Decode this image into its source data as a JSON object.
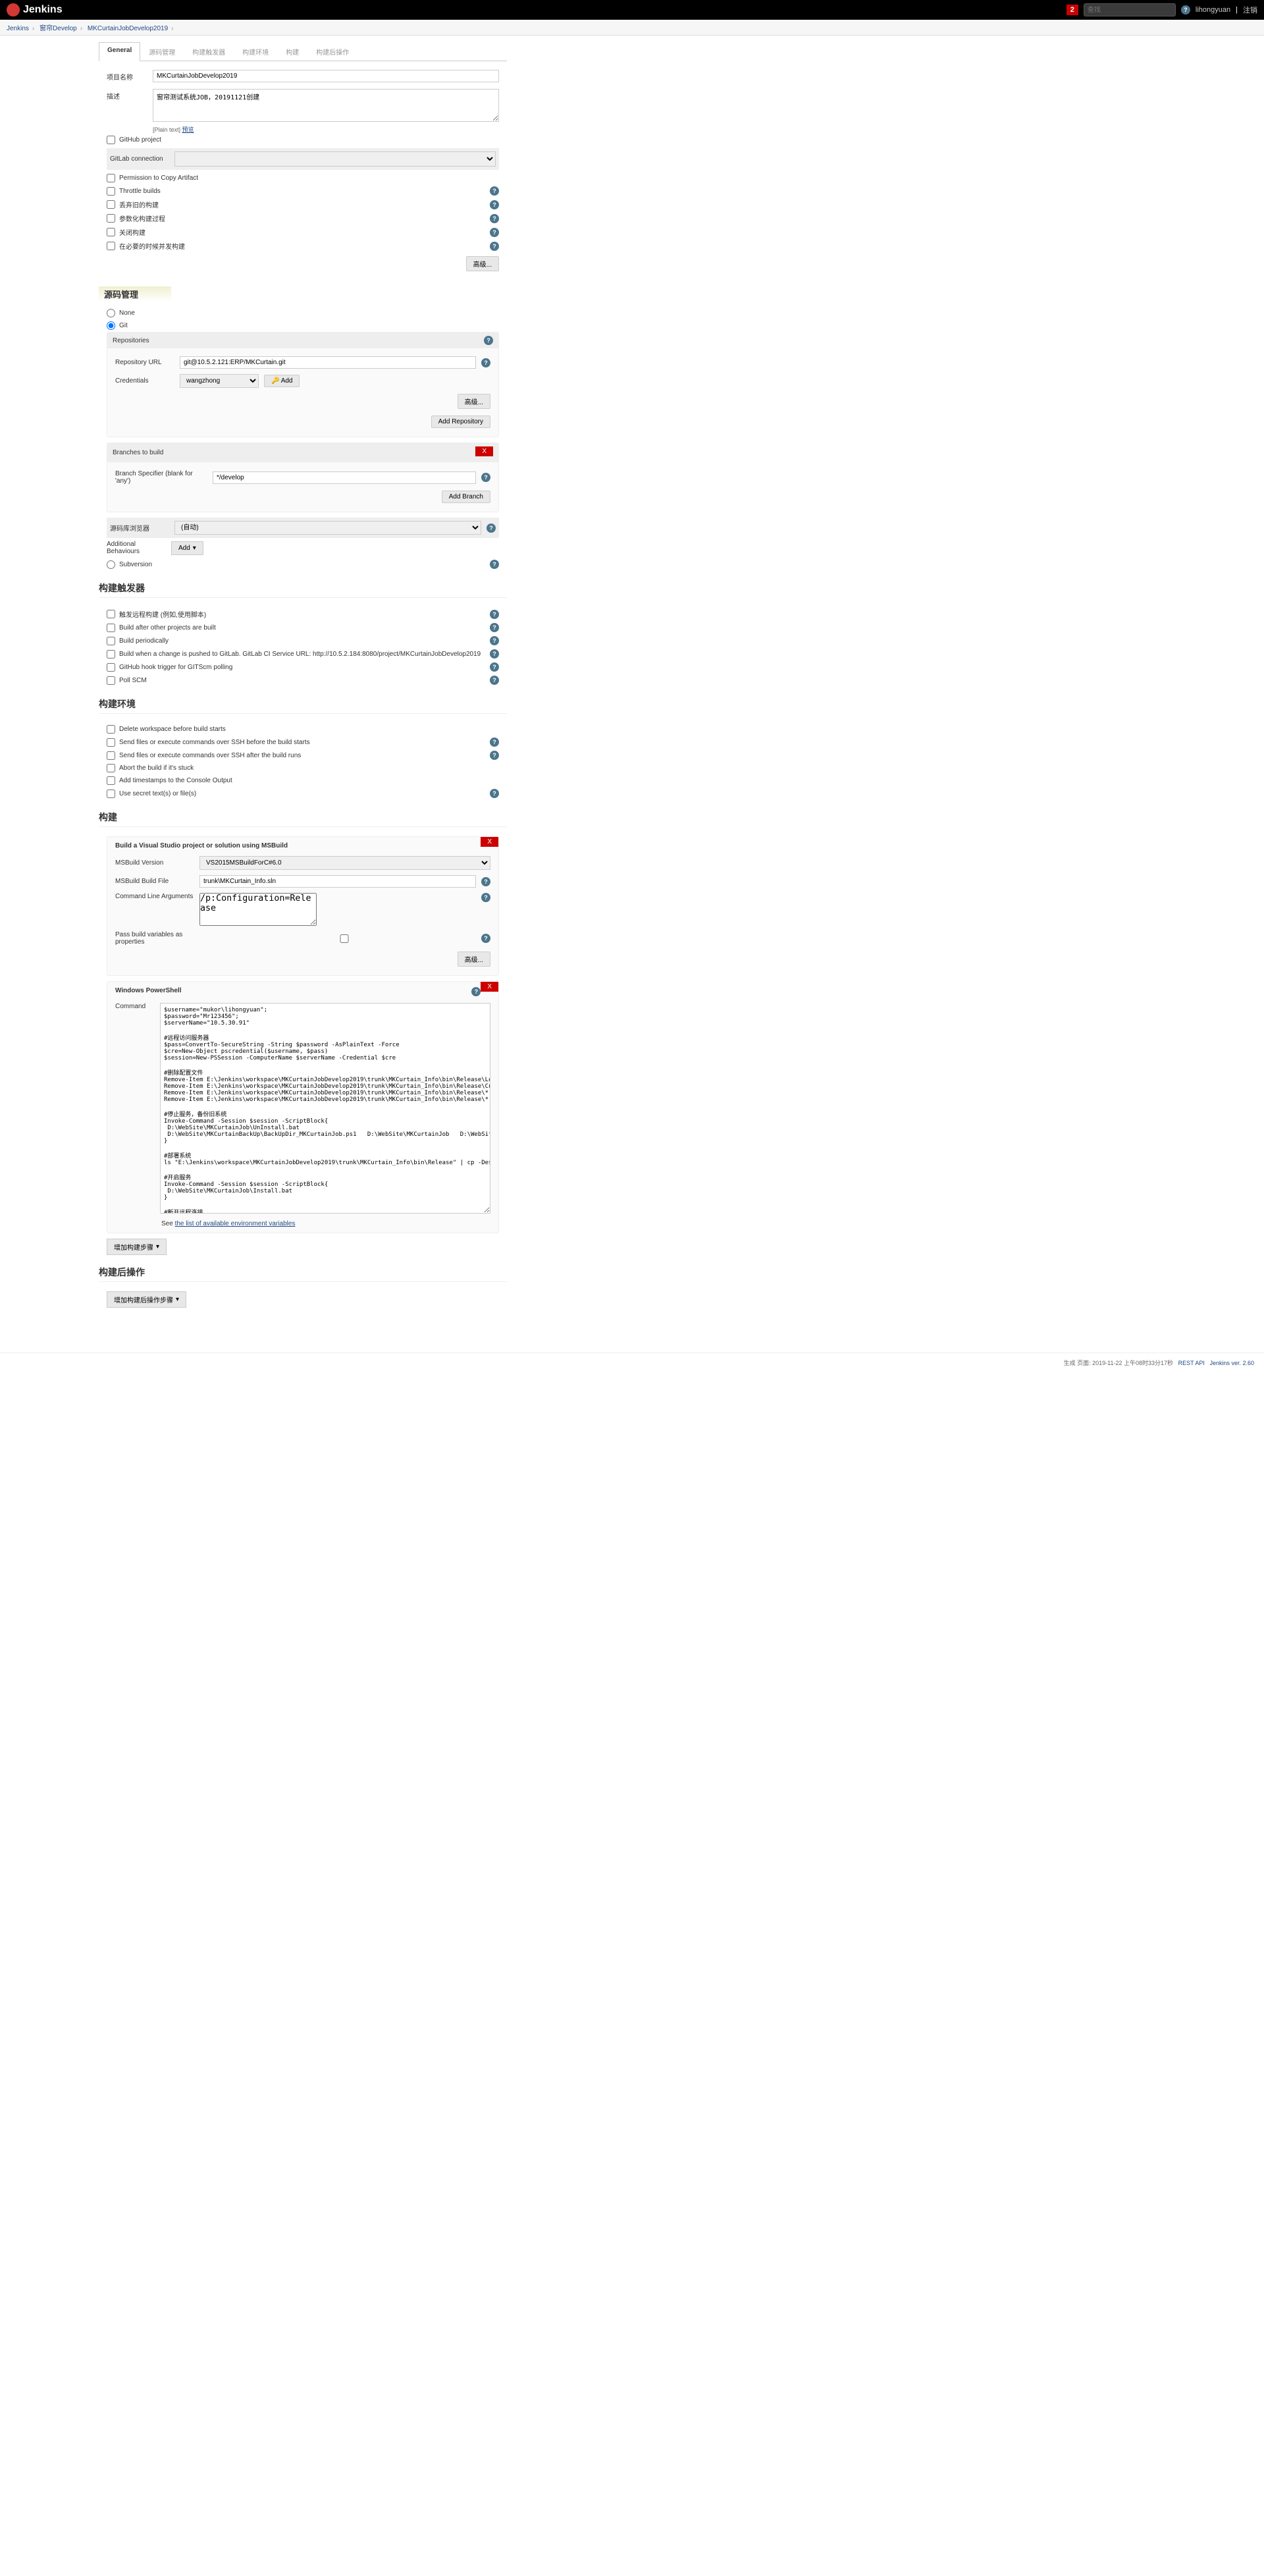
{
  "header": {
    "appName": "Jenkins",
    "badge": "2",
    "searchPlaceholder": "查找",
    "user": "lihongyuan",
    "logout": "注销"
  },
  "breadcrumb": {
    "root": "Jenkins",
    "folder": "窗帘Develop",
    "job": "MKCurtainJobDevelop2019"
  },
  "tabs": [
    "General",
    "源码管理",
    "构建触发器",
    "构建环境",
    "构建",
    "构建后操作"
  ],
  "general": {
    "nameLabel": "项目名称",
    "nameValue": "MKCurtainJobDevelop2019",
    "descLabel": "描述",
    "descValue": "窗帘测试系统JOB，20191121创建",
    "formatHint": "[Plain text]",
    "previewLink": "预览",
    "github": "GitHub project",
    "gitlabConn": "GitLab connection",
    "checks": [
      "Permission to Copy Artifact",
      "Throttle builds",
      "丢弃旧的构建",
      "参数化构建过程",
      "关闭构建",
      "在必要的时候并发构建"
    ],
    "advanced": "高级..."
  },
  "scm": {
    "title": "源码管理",
    "none": "None",
    "git": "Git",
    "svn": "Subversion",
    "repos": "Repositories",
    "repoUrl": "Repository URL",
    "repoUrlVal": "git@10.5.2.121:ERP/MKCurtain.git",
    "creds": "Credentials",
    "credsVal": "wangzhong",
    "addBtn": "Add",
    "advanced": "高级...",
    "addRepo": "Add Repository",
    "branches": "Branches to build",
    "branchSpec": "Branch Specifier (blank for 'any')",
    "branchVal": "*/develop",
    "addBranch": "Add Branch",
    "browser": "源码库浏览器",
    "browserVal": "(自动)",
    "addBehav": "Additional Behaviours",
    "addBtn2": "Add"
  },
  "triggers": {
    "title": "构建触发器",
    "items": [
      "触发远程构建 (例如,使用脚本)",
      "Build after other projects are built",
      "Build periodically",
      "Build when a change is pushed to GitLab. GitLab CI Service URL: http://10.5.2.184:8080/project/MKCurtainJobDevelop2019",
      "GitHub hook trigger for GITScm polling",
      "Poll SCM"
    ]
  },
  "env": {
    "title": "构建环境",
    "items": [
      "Delete workspace before build starts",
      "Send files or execute commands over SSH before the build starts",
      "Send files or execute commands over SSH after the build runs",
      "Abort the build if it's stuck",
      "Add timestamps to the Console Output",
      "Use secret text(s) or file(s)"
    ]
  },
  "build": {
    "title": "构建",
    "msbuild": {
      "title": "Build a Visual Studio project or solution using MSBuild",
      "verLabel": "MSBuild Version",
      "verVal": "VS2015MSBuildForC#6.0",
      "fileLabel": "MSBuild Build File",
      "fileVal": "trunk\\MKCurtain_Info.sln",
      "argsLabel": "Command Line Arguments",
      "argsVal": "/p:Configuration=Release",
      "passVars": "Pass build variables as properties",
      "advanced": "高级..."
    },
    "ps": {
      "title": "Windows PowerShell",
      "cmdLabel": "Command",
      "cmdVal": "$username=\"mukor\\lihongyuan\";\n$password=\"Mr123456\";\n$serverName=\"10.5.30.91\"\n\n#远程访问服务器\n$pass=ConvertTo-SecureString -String $password -AsPlainText -Force\n$cre=New-Object pscredential($username, $pass)\n$session=New-PSSession -ComputerName $serverName -Credential $cre\n\n#删除配置文件\nRemove-Item E:\\Jenkins\\workspace\\MKCurtainJobDevelop2019\\trunk\\MKCurtain_Info\\bin\\Release\\Logs -recurse\nRemove-Item E:\\Jenkins\\workspace\\MKCurtainJobDevelop2019\\trunk\\MKCurtain_Info\\bin\\Release\\CurtainTransferDataLog -recurse\nRemove-Item E:\\Jenkins\\workspace\\MKCurtainJobDevelop2019\\trunk\\MKCurtain_Info\\bin\\Release\\*.exe.config -recurse\nRemove-Item E:\\Jenkins\\workspace\\MKCurtainJobDevelop2019\\trunk\\MKCurtain_Info\\bin\\Release\\*.bat -recurse\n\n#停止服务，备份旧系统\nInvoke-Command -Session $session -ScriptBlock{\n D:\\WebSite\\MKCurtainJob\\UnInstall.bat\n D:\\WebSite\\MKCurtainBackUp\\BackUpDir_MKCurtainJob.ps1   D:\\WebSite\\MKCurtainJob   D:\\WebSite\\MKCurtainBackUp\\MKCurtainJob\n}\n\n#部署系统\nls \"E:\\Jenkins\\workspace\\MKCurtainJobDevelop2019\\trunk\\MKCurtain_Info\\bin\\Release\" | cp -Destination \"D:\\WebSite\\MKCurtainJob\\\" -ToSession $session -Recurse -Force\n\n#开启服务\nInvoke-Command -Session $session -ScriptBlock{\n D:\\WebSite\\MKCurtainJob\\Install.bat\n}\n\n#断开远程连接\nRemove-PSSession -Id $session.Id",
      "seeText": "See ",
      "envLink": "the list of available environment variables"
    },
    "addStep": "增加构建步骤"
  },
  "post": {
    "title": "构建后操作",
    "addStep": "增加构建后操作步骤"
  },
  "footer": {
    "gen": "生成 页面: 2019-11-22 上午08时33分17秒",
    "rest": "REST API",
    "ver": "Jenkins ver. 2.60"
  }
}
